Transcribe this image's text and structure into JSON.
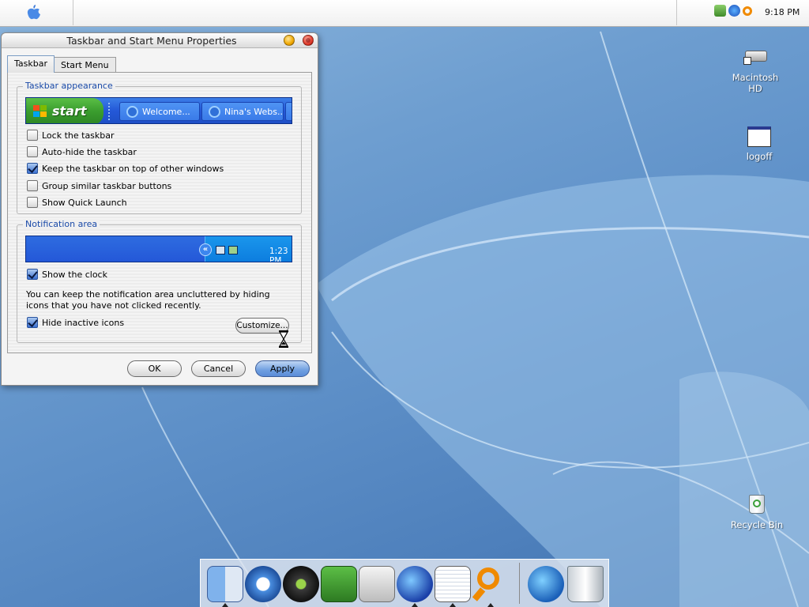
{
  "menubar": {
    "clock": "9:18 PM",
    "tray_icons": [
      "network-icon",
      "browser-icon",
      "search-icon"
    ]
  },
  "dialog": {
    "title": "Taskbar and Start Menu Properties",
    "tabs": [
      {
        "label": "Taskbar",
        "active": true
      },
      {
        "label": "Start Menu",
        "active": false
      }
    ],
    "taskbar_appearance": {
      "label": "Taskbar appearance",
      "preview": {
        "start_label": "start",
        "tasks": [
          "Welcome...",
          "Nina's Webs..."
        ]
      },
      "options": [
        {
          "label": "Lock the taskbar",
          "checked": false
        },
        {
          "label": "Auto-hide the taskbar",
          "checked": false
        },
        {
          "label": "Keep the taskbar on top of other windows",
          "checked": true
        },
        {
          "label": "Group similar taskbar buttons",
          "checked": false
        },
        {
          "label": "Show Quick Launch",
          "checked": false
        }
      ]
    },
    "notification_area": {
      "label": "Notification area",
      "preview_time": "1:23 PM",
      "show_clock": {
        "label": "Show the clock",
        "checked": true
      },
      "description": "You can keep the notification area uncluttered by hiding icons that you have not clicked recently.",
      "hide_inactive": {
        "label": "Hide inactive icons",
        "checked": true
      },
      "customize_label": "Customize..."
    },
    "buttons": {
      "ok": "OK",
      "cancel": "Cancel",
      "apply": "Apply"
    }
  },
  "desktop_icons": [
    {
      "label": "Macintosh HD",
      "icon": "hard-drive-icon"
    },
    {
      "label": "logoff",
      "icon": "window-icon"
    },
    {
      "label": "Recycle Bin",
      "icon": "recycle-bin-icon"
    }
  ],
  "dock": {
    "items": [
      "finder-icon",
      "safari-icon",
      "itunes-icon",
      "iphoto-icon",
      "utilities-icon",
      "browser-icon",
      "textedit-icon",
      "search-icon",
      "internet-icon",
      "trash-icon"
    ]
  }
}
